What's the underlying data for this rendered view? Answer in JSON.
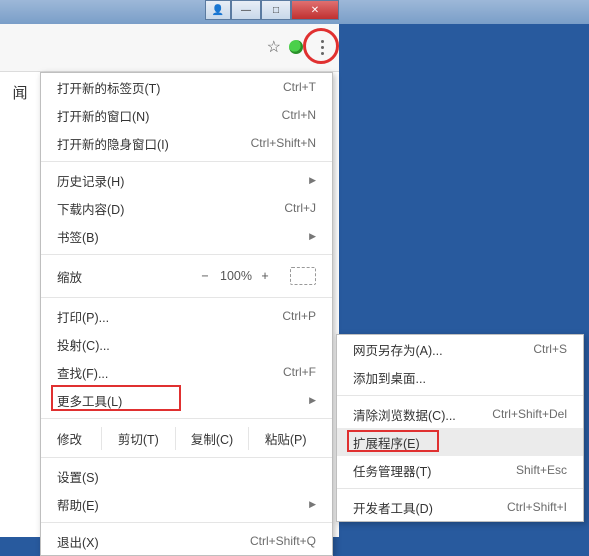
{
  "titlebar": {
    "user": "👤",
    "min": "—",
    "max": "□",
    "close": "✕"
  },
  "toolbar": {
    "star": "☆"
  },
  "left_strip": "闻",
  "menu": {
    "new_tab": {
      "label": "打开新的标签页(T)",
      "shortcut": "Ctrl+T"
    },
    "new_window": {
      "label": "打开新的窗口(N)",
      "shortcut": "Ctrl+N"
    },
    "new_incognito": {
      "label": "打开新的隐身窗口(I)",
      "shortcut": "Ctrl+Shift+N"
    },
    "history": {
      "label": "历史记录(H)"
    },
    "downloads": {
      "label": "下载内容(D)",
      "shortcut": "Ctrl+J"
    },
    "bookmarks": {
      "label": "书签(B)"
    },
    "zoom": {
      "label": "缩放",
      "minus": "−",
      "value": "100%",
      "plus": "+"
    },
    "print": {
      "label": "打印(P)...",
      "shortcut": "Ctrl+P"
    },
    "cast": {
      "label": "投射(C)..."
    },
    "find": {
      "label": "查找(F)...",
      "shortcut": "Ctrl+F"
    },
    "more_tools": {
      "label": "更多工具(L)"
    },
    "edit": {
      "label": "修改",
      "cut": "剪切(T)",
      "copy": "复制(C)",
      "paste": "粘贴(P)"
    },
    "settings": {
      "label": "设置(S)"
    },
    "help": {
      "label": "帮助(E)"
    },
    "exit": {
      "label": "退出(X)",
      "shortcut": "Ctrl+Shift+Q"
    }
  },
  "submenu": {
    "save_as": {
      "label": "网页另存为(A)...",
      "shortcut": "Ctrl+S"
    },
    "add_desktop": {
      "label": "添加到桌面..."
    },
    "clear_data": {
      "label": "清除浏览数据(C)...",
      "shortcut": "Ctrl+Shift+Del"
    },
    "extensions": {
      "label": "扩展程序(E)"
    },
    "task_manager": {
      "label": "任务管理器(T)",
      "shortcut": "Shift+Esc"
    },
    "dev_tools": {
      "label": "开发者工具(D)",
      "shortcut": "Ctrl+Shift+I"
    }
  }
}
